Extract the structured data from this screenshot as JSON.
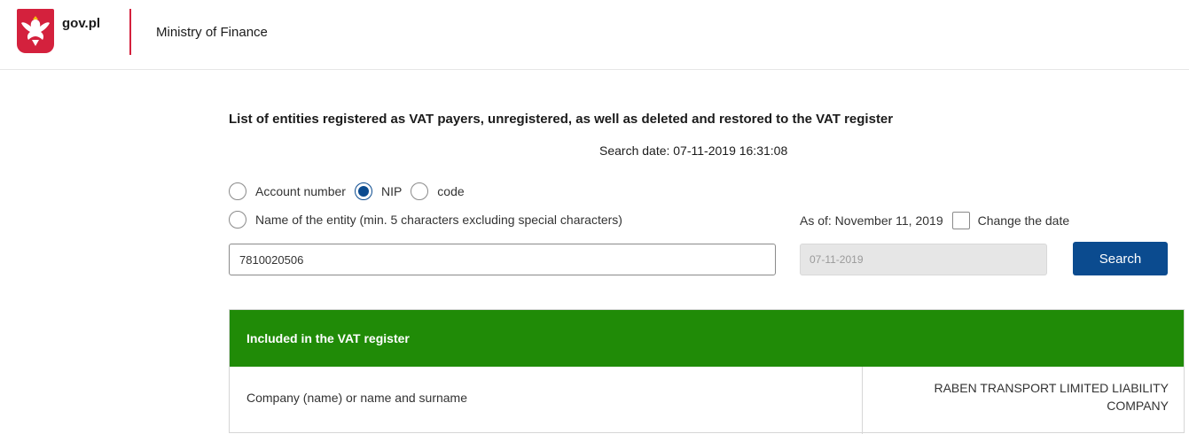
{
  "header": {
    "site_name": "gov.pl",
    "ministry": "Ministry of Finance",
    "brand_color": "#d4213d"
  },
  "page": {
    "title": "List of entities registered as VAT payers, unregistered, as well as deleted and restored to the VAT register",
    "search_date": "Search date: 07-11-2019 16:31:08"
  },
  "search_options": {
    "account_number": "Account number",
    "nip": "NIP",
    "code": "code",
    "entity_name": "Name of the entity (min. 5 characters excluding special characters)",
    "selected": "NIP"
  },
  "date_options": {
    "as_of": "As of: November 11, 2019",
    "change_date": "Change the date"
  },
  "form": {
    "nip_value": "7810020506",
    "date_value": "07-11-2019",
    "search_label": "Search",
    "button_color": "#0b4b8f"
  },
  "result": {
    "status": "Included in the VAT register",
    "status_color": "#208b07",
    "rows": [
      {
        "label": "Company (name) or name and surname",
        "value": "RABEN TRANSPORT LIMITED LIABILITY COMPANY"
      }
    ]
  }
}
